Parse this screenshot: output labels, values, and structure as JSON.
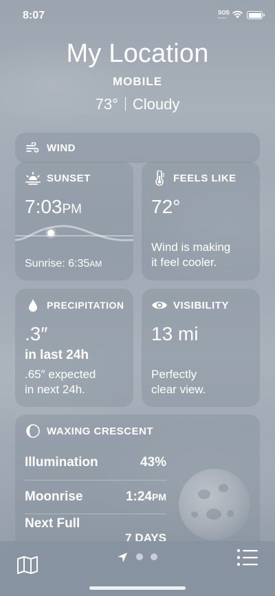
{
  "status_bar": {
    "time": "8:07",
    "sos": "SOS"
  },
  "header": {
    "location": "My Location",
    "subtitle": "MOBILE",
    "temperature": "73°",
    "condition": "Cloudy"
  },
  "wind_card": {
    "title": "WIND"
  },
  "sunset_card": {
    "title": "SUNSET",
    "time": "7:03",
    "ampm": "PM",
    "sunrise_label": "Sunrise: 6:35",
    "sunrise_ampm": "AM"
  },
  "feels_card": {
    "title": "FEELS LIKE",
    "value": "72°",
    "line1": "Wind is making",
    "line2": "it feel cooler."
  },
  "precip_card": {
    "title": "PRECIPITATION",
    "value": ".3″",
    "period": "in last 24h",
    "line1": ".65″ expected",
    "line2": "in next 24h."
  },
  "visibility_card": {
    "title": "VISIBILITY",
    "value": "13 mi",
    "line1": "Perfectly",
    "line2": "clear view."
  },
  "moon_card": {
    "title": "WAXING CRESCENT",
    "rows": [
      {
        "label": "Illumination",
        "value": "43%",
        "suffix": ""
      },
      {
        "label": "Moonrise",
        "value": "1:24",
        "suffix": "PM"
      },
      {
        "label": "Next Full",
        "value": "7 DAYS",
        "suffix": ""
      }
    ]
  },
  "icons": {
    "wind": "wind-icon",
    "sunset": "sunset-icon",
    "feels": "thermometer-icon",
    "precip": "drop-icon",
    "visibility": "eye-icon",
    "moon": "moon-phase-icon",
    "map": "map-icon",
    "location": "location-arrow-icon",
    "list": "list-icon"
  }
}
